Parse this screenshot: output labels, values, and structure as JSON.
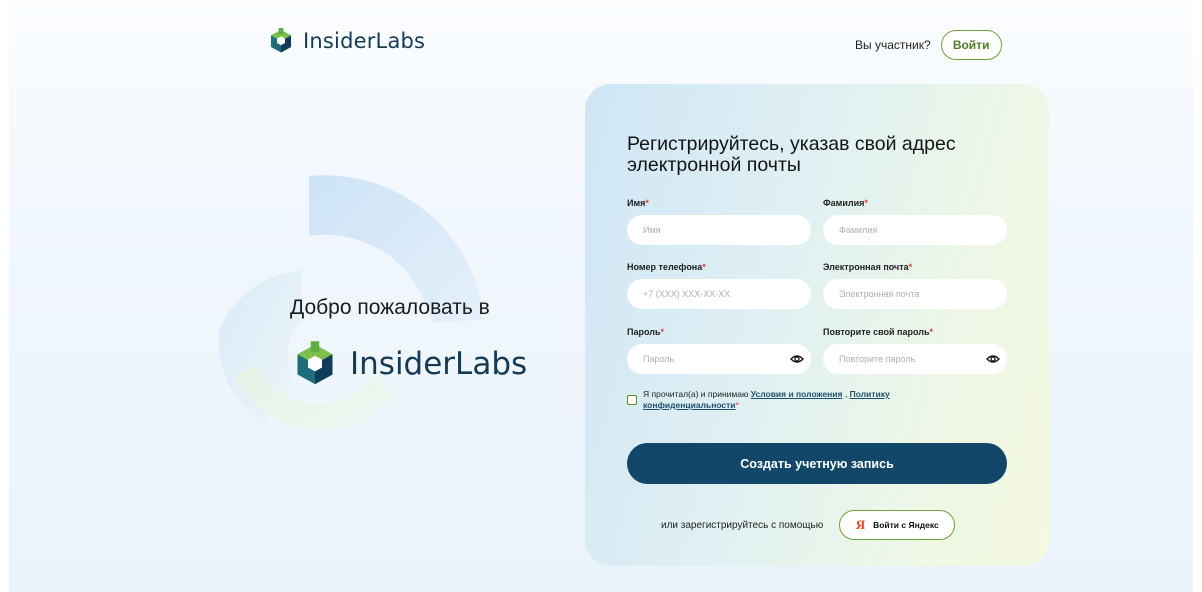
{
  "brand": {
    "name": "InsiderLabs"
  },
  "header": {
    "member_question": "Вы участник?",
    "login_label": "Войти"
  },
  "welcome": {
    "title": "Добро пожаловать в"
  },
  "form": {
    "title": "Регистрируйтесь, указав свой адрес электронной почты",
    "first_name": {
      "label": "Имя",
      "placeholder": "Имя",
      "value": ""
    },
    "last_name": {
      "label": "Фамилия",
      "placeholder": "Фамилия",
      "value": ""
    },
    "phone": {
      "label": "Номер телефона",
      "placeholder": "+7 (XXX) XXX-XX-XX",
      "value": ""
    },
    "email": {
      "label": "Электронная почта",
      "placeholder": "Электронная почта",
      "value": ""
    },
    "password": {
      "label": "Пароль",
      "placeholder": "Пароль",
      "value": ""
    },
    "password_repeat": {
      "label": "Повторите свой пароль",
      "placeholder": "Повторите пароль",
      "value": ""
    },
    "required_mark": "*",
    "consent": {
      "prefix": "Я прочитал(а) и принимаю",
      "terms_link": "Условия и положения",
      "separator": ",",
      "policy_link_1": "Политику",
      "policy_link_2": "конфиденциальности",
      "checked": false
    },
    "submit_label": "Создать учетную запись",
    "alt_text": "или зарегистрируйтесь с помощью",
    "yandex": {
      "glyph": "Я",
      "label": "Войти с Яндекс"
    }
  },
  "colors": {
    "primary": "#12476a",
    "accent_green": "#6fa23a",
    "brand_dark": "#143b55",
    "required": "#e53935",
    "yandex_red": "#fc3f1d"
  },
  "icons": [
    "insiderlabs-logo-icon",
    "eye-icon",
    "yandex-icon"
  ]
}
